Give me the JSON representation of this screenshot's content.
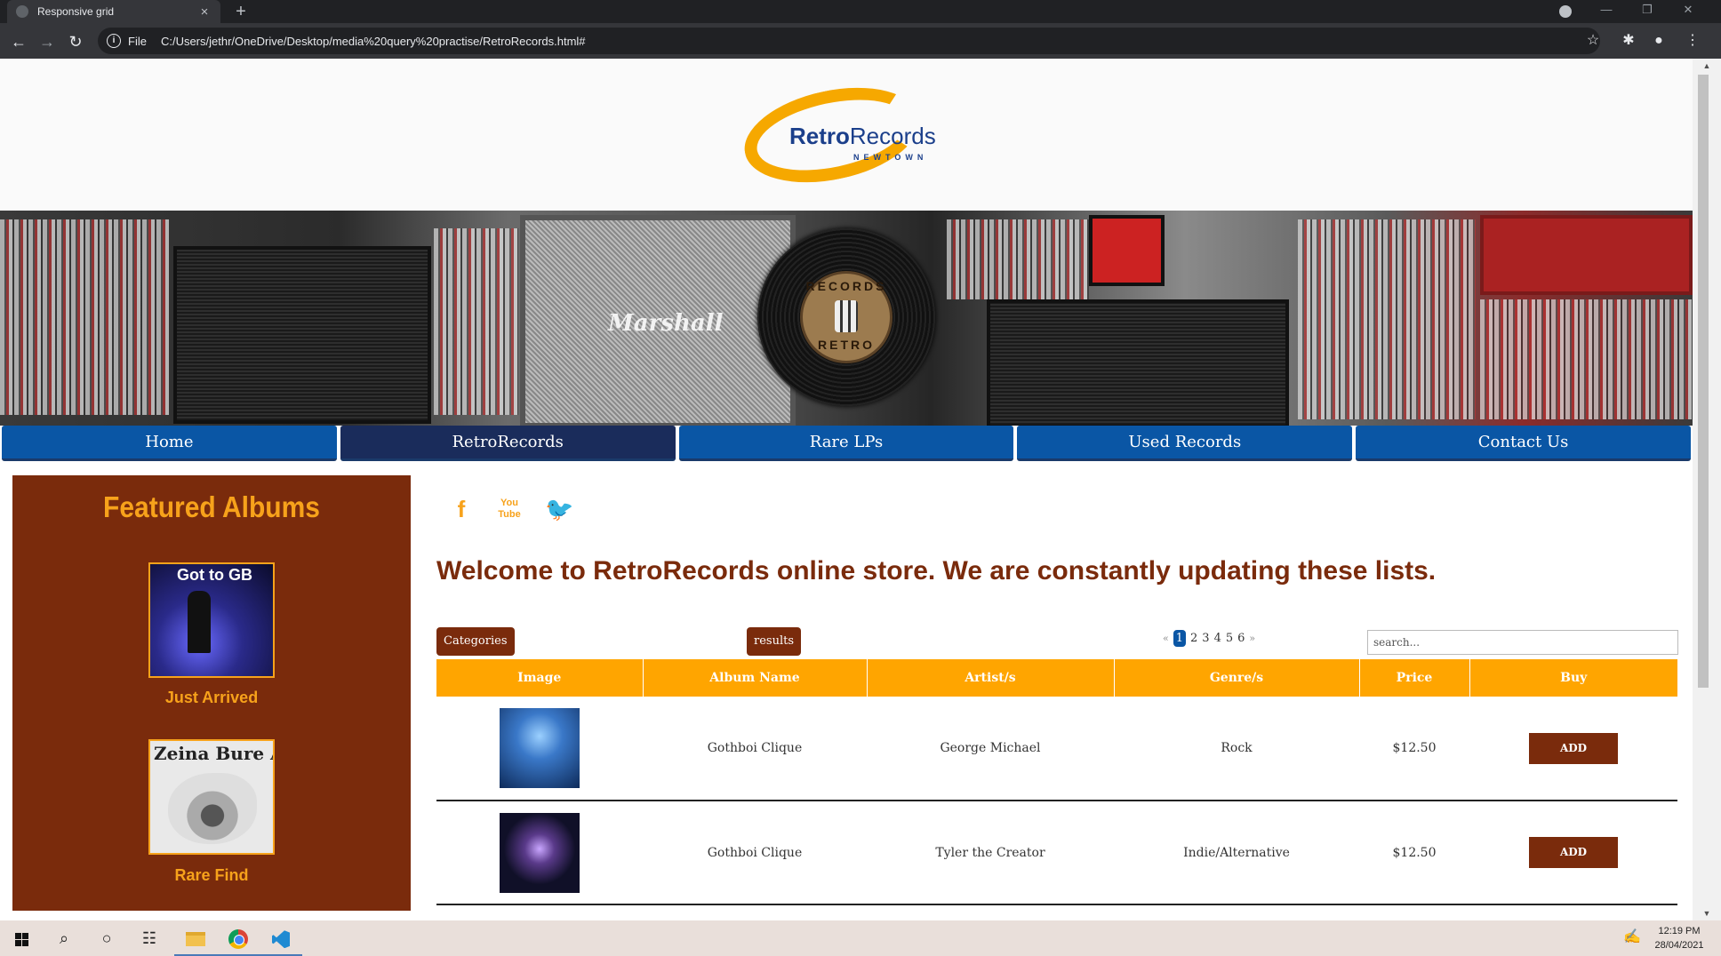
{
  "browser": {
    "tab_title": "Responsive grid",
    "new_tab": "+",
    "scheme": "File",
    "url": "C:/Users/jethr/OneDrive/Desktop/media%20query%20practise/RetroRecords.html#"
  },
  "logo": {
    "bold": "Retro",
    "regular": "Records",
    "sub": "NEWTOWN"
  },
  "banner": {
    "amp_brand": "Marshall",
    "vinyl_top": "RECORDS",
    "vinyl_bottom": "RETRO"
  },
  "nav": [
    "Home",
    "RetroRecords",
    "Rare LPs",
    "Used Records",
    "Contact Us"
  ],
  "nav_active": "RetroRecords",
  "sidebar": {
    "title": "Featured Albums",
    "albums": [
      {
        "cover_text": "Got to GB",
        "caption": "Just Arrived"
      },
      {
        "cover_text": "Zeina Bure AVE",
        "caption": "Rare Find"
      }
    ]
  },
  "socials": [
    {
      "name": "facebook",
      "glyph": "f"
    },
    {
      "name": "youtube",
      "glyph": "You Tube"
    },
    {
      "name": "twitter",
      "glyph": "🐦"
    }
  ],
  "main": {
    "welcome": "Welcome to RetroRecords online store. We are constantly updating these lists.",
    "categories_label": "Categories",
    "results_label": "results",
    "pager": {
      "prev": "«",
      "pages": [
        "1",
        "2",
        "3",
        "4",
        "5",
        "6"
      ],
      "current": "1",
      "next": "»"
    },
    "search_placeholder": "search..."
  },
  "table": {
    "headers": [
      "Image",
      "Album Name",
      "Artist/s",
      "Genre/s",
      "Price",
      "Buy"
    ],
    "rows": [
      {
        "album": "Gothboi Clique",
        "artist": "George Michael",
        "genre": "Rock",
        "price": "$12.50",
        "buy": "ADD"
      },
      {
        "album": "Gothboi Clique",
        "artist": "Tyler the Creator",
        "genre": "Indie/Alternative",
        "price": "$12.50",
        "buy": "ADD"
      }
    ]
  },
  "colors": {
    "brown": "#7a2b0c",
    "orange": "#ffa500",
    "accent_orange": "#f7a21b",
    "nav_blue": "#0a56a5",
    "nav_active": "#1a2c5b"
  },
  "taskbar": {
    "time": "12:19 PM",
    "date": "28/04/2021"
  }
}
